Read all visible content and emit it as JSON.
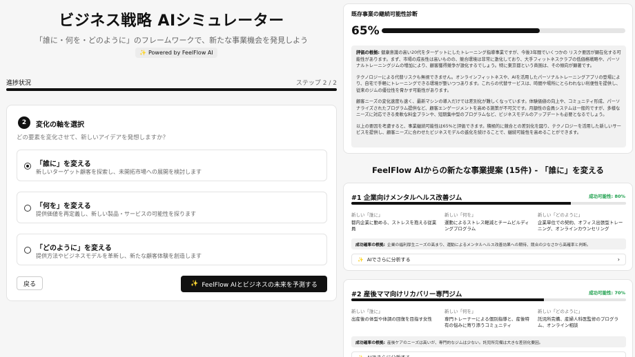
{
  "header": {
    "title": "ビジネス戦略 AIシミュレーター",
    "subtitle": "「誰に・何を・どのように」のフレームワークで、新たな事業機会を発見しよう",
    "powered_by": "Powered by FeelFlow AI"
  },
  "progress": {
    "label": "進捗状況",
    "step_text": "ステップ 2 / 2",
    "value": 1.0
  },
  "step": {
    "number": "2",
    "title": "変化の軸を選択",
    "description": "どの要素を変化させて、新しいアイデアを発想しますか？",
    "options": [
      {
        "title": "「誰に」を変える",
        "description": "新しいターゲット顧客を探索し、未開拓市場への展開を検討します",
        "selected": true
      },
      {
        "title": "「何を」を変える",
        "description": "提供価値を再定義し、新しい製品・サービスの可能性を探ります",
        "selected": false
      },
      {
        "title": "「どのように」を変える",
        "description": "提供方法やビジネスモデルを革新し、新たな顧客体験を創造します",
        "selected": false
      }
    ],
    "back_label": "戻る",
    "predict_label": "FeelFlow AIとビジネスの未来を予測する"
  },
  "diagnosis": {
    "label": "既存事業の継続可能性診断",
    "percent_text": "65%",
    "value": 0.65,
    "paragraphs": [
      {
        "lead": "評価の根拠:",
        "text": " 健康意識の高い20代をターゲットにしたトレーニング指導事業ですが、今後3年間でいくつかの リスク要因が顕在化する可能性があります。まず、市場の成長性は高いものの、競合環境は非常に激化しており、大手フィットネスクラブの低価格戦略や、パーソナルトレーニングジムの増加により、顧客獲得競争が激化するでしょう。特に東京都という商圏は、その傾向が顕著です。"
      },
      {
        "lead": "",
        "text": "テクノロジーによる代替リスクも無視できません。オンラインフィットネスや、AIを活用したパーソナルトレーニングアプリの登場により、自宅で手軽にトレーニングできる環境が整いつつあります。これらの代替サービスは、時間や場所にとらわれない利便性を提供し、従来のジムの優位性を脅かす可能性があります。"
      },
      {
        "lead": "",
        "text": "顧客ニーズの変化速度も速く、最新マシンの導入だけでは差別化が難しくなっています。体験価値の向上や、コミュニティ形成、パーソナライズされたプログラム提供など、顧客エンゲージメントを高める施策が不可欠です。月額性の会員システムは一般的ですが、多様なニーズに対応できる柔軟な料金プランや、短期集中型のプログラムなど、ビジネスモデルのアップデートも必要となるでしょう。"
      },
      {
        "lead": "",
        "text": "以上の要因を考慮すると、事業継続可能性は65%と評価できます。積極的に競合との差別化を図り、テクノロジーを活用した新しいサービスを提供し、顧客ニーズに合わせたビジネスモデルの進化を続けることで、継続可能性を高めることができます。"
      }
    ]
  },
  "proposals": {
    "title": "FeelFlow AIからの新たな事業提案 (15件) - 「誰に」を変える",
    "who_label": "新しい「誰に」",
    "what_label": "新しい「何を」",
    "how_label": "新しい「どのように」",
    "reason_label": "成功確率の根拠:",
    "analyze_label": "AIでさらに分析する",
    "items": [
      {
        "title": "#1 企業向けメンタルヘルス改善ジム",
        "rate_text": "成功可能性: 80%",
        "rate": 0.8,
        "who": "都内企業に勤める、ストレスを抱える従業員",
        "what": "運動によるストレス軽減とチームビルディングプログラム",
        "how": "企業単位での契約、オフィス出張型トレーニング、オンラインカウンセリング",
        "reason": "企業の福利厚生ニーズの高まり、運動によるメンタルヘルス改善効果への期待、競合の少なさから高確率と判断。"
      },
      {
        "title": "#2 産後ママ向けリカバリー専門ジム",
        "rate_text": "成功可能性: 70%",
        "rate": 0.7,
        "who": "出産後の体型や体調の回復を目指す女性",
        "what": "専門トレーナーによる個別指導と、産後特有の悩みに寄り添うコミュニティ",
        "how": "託児所完備、産婦人科医監修のプログラム、オンライン相談",
        "reason": "産後ケアのニーズは高いが、専門的なジムは少ない。託児所完備は大きな差別化要因。"
      }
    ]
  },
  "colors": {
    "accent": "#111111",
    "success": "#1a9e4a"
  }
}
